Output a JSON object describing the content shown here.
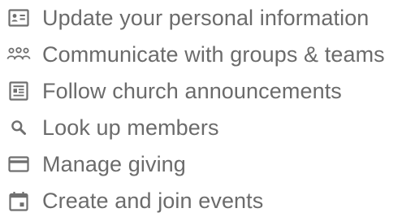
{
  "features": [
    {
      "label": "Update your personal information",
      "icon": "id-card-icon"
    },
    {
      "label": "Communicate with groups & teams",
      "icon": "people-group-icon"
    },
    {
      "label": "Follow church announcements",
      "icon": "newspaper-icon"
    },
    {
      "label": "Look up members",
      "icon": "search-icon"
    },
    {
      "label": "Manage giving",
      "icon": "credit-card-icon"
    },
    {
      "label": "Create and join events",
      "icon": "calendar-icon"
    }
  ],
  "colors": {
    "text": "#6b6b6b",
    "icon": "#6f6f6f",
    "background": "#ffffff"
  }
}
